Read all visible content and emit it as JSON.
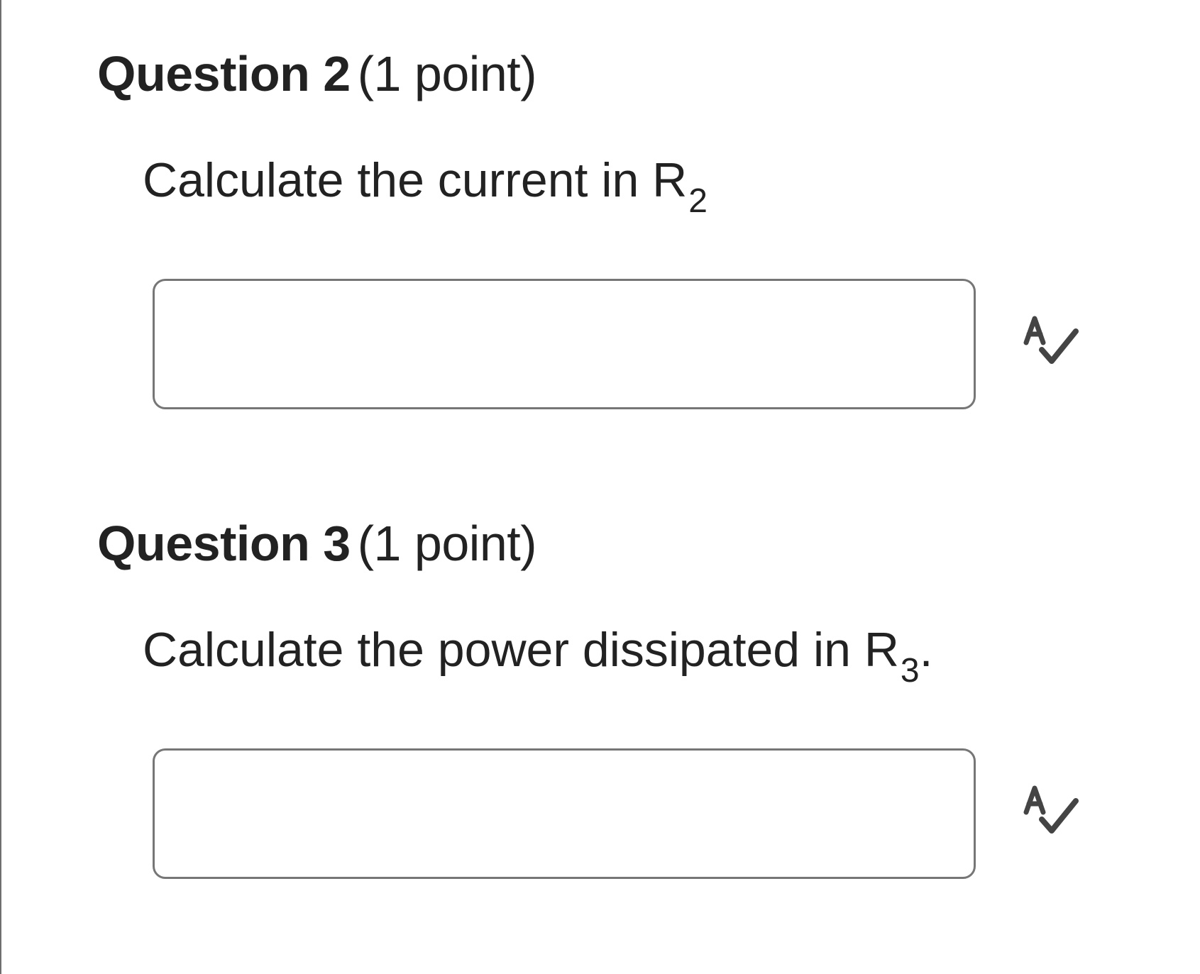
{
  "questions": [
    {
      "title": "Question 2",
      "points": "(1 point)",
      "prompt_text": "Calculate the current in R",
      "prompt_subscript": "2",
      "prompt_suffix": "",
      "answer_value": "",
      "spellcheck_icon": "spell-check-icon"
    },
    {
      "title": "Question 3",
      "points": "(1 point)",
      "prompt_text": "Calculate the power dissipated in R",
      "prompt_subscript": "3",
      "prompt_suffix": ".",
      "answer_value": "",
      "spellcheck_icon": "spell-check-icon"
    }
  ],
  "colors": {
    "text": "#222222",
    "input_border": "#767676",
    "icon": "#444444",
    "left_border": "#6f6f6f"
  }
}
